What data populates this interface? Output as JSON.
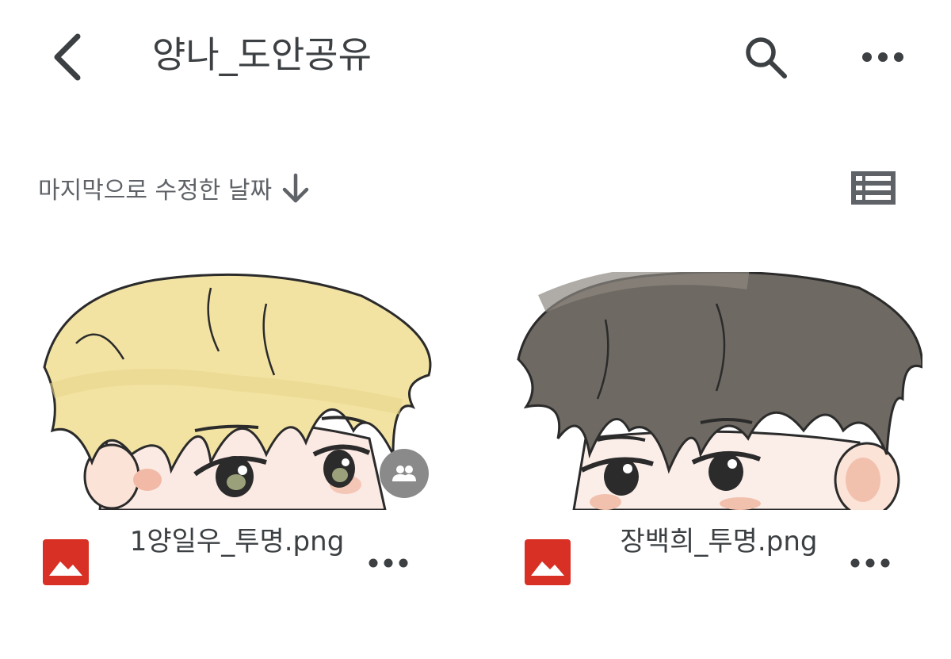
{
  "header": {
    "title": "양나_도안공유",
    "back_icon": "chevron-left-icon",
    "search_icon": "search-icon",
    "more_icon": "more-horizontal-icon"
  },
  "sort": {
    "label": "마지막으로 수정한 날짜",
    "direction_icon": "arrow-down-icon",
    "view_icon": "list-view-icon"
  },
  "files": [
    {
      "name": "1양일우_투명.png",
      "type_icon": "image-file-icon",
      "type_color": "#d93025",
      "shared": true,
      "shared_icon": "people-icon"
    },
    {
      "name": "장백희_투명.png",
      "type_icon": "image-file-icon",
      "type_color": "#d93025",
      "shared": false
    }
  ]
}
